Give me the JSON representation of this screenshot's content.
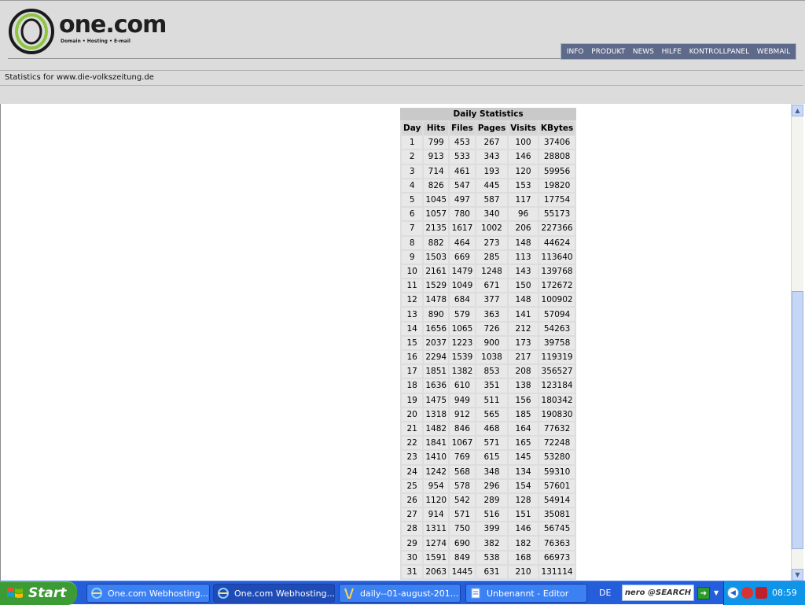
{
  "header": {
    "logo_text": "one.com",
    "logo_tagline": "Domain • Hosting • E-mail",
    "stats_label": "Statistics for www.die-volkszeitung.de"
  },
  "nav": {
    "items": [
      "INFO",
      "PRODUKT",
      "NEWS",
      "HILFE",
      "KONTROLLPANEL",
      "WEBMAIL"
    ]
  },
  "daily_table": {
    "title": "Daily Statistics",
    "columns": [
      "Day",
      "Hits",
      "Files",
      "Pages",
      "Visits",
      "KBytes"
    ],
    "rows": [
      [
        "1",
        "799",
        "453",
        "267",
        "100",
        "37406"
      ],
      [
        "2",
        "913",
        "533",
        "343",
        "146",
        "28808"
      ],
      [
        "3",
        "714",
        "461",
        "193",
        "120",
        "59956"
      ],
      [
        "4",
        "826",
        "547",
        "445",
        "153",
        "19820"
      ],
      [
        "5",
        "1045",
        "497",
        "587",
        "117",
        "17754"
      ],
      [
        "6",
        "1057",
        "780",
        "340",
        "96",
        "55173"
      ],
      [
        "7",
        "2135",
        "1617",
        "1002",
        "206",
        "227366"
      ],
      [
        "8",
        "882",
        "464",
        "273",
        "148",
        "44624"
      ],
      [
        "9",
        "1503",
        "669",
        "285",
        "113",
        "113640"
      ],
      [
        "10",
        "2161",
        "1479",
        "1248",
        "143",
        "139768"
      ],
      [
        "11",
        "1529",
        "1049",
        "671",
        "150",
        "172672"
      ],
      [
        "12",
        "1478",
        "684",
        "377",
        "148",
        "100902"
      ],
      [
        "13",
        "890",
        "579",
        "363",
        "141",
        "57094"
      ],
      [
        "14",
        "1656",
        "1065",
        "726",
        "212",
        "54263"
      ],
      [
        "15",
        "2037",
        "1223",
        "900",
        "173",
        "39758"
      ],
      [
        "16",
        "2294",
        "1539",
        "1038",
        "217",
        "119319"
      ],
      [
        "17",
        "1851",
        "1382",
        "853",
        "208",
        "356527"
      ],
      [
        "18",
        "1636",
        "610",
        "351",
        "138",
        "123184"
      ],
      [
        "19",
        "1475",
        "949",
        "511",
        "156",
        "180342"
      ],
      [
        "20",
        "1318",
        "912",
        "565",
        "185",
        "190830"
      ],
      [
        "21",
        "1482",
        "846",
        "468",
        "164",
        "77632"
      ],
      [
        "22",
        "1841",
        "1067",
        "571",
        "165",
        "72248"
      ],
      [
        "23",
        "1410",
        "769",
        "615",
        "145",
        "53280"
      ],
      [
        "24",
        "1242",
        "568",
        "348",
        "134",
        "59310"
      ],
      [
        "25",
        "954",
        "578",
        "296",
        "154",
        "57601"
      ],
      [
        "26",
        "1120",
        "542",
        "289",
        "128",
        "54914"
      ],
      [
        "27",
        "914",
        "571",
        "516",
        "151",
        "35081"
      ],
      [
        "28",
        "1311",
        "750",
        "399",
        "146",
        "56745"
      ],
      [
        "29",
        "1274",
        "690",
        "382",
        "182",
        "76363"
      ],
      [
        "30",
        "1591",
        "849",
        "538",
        "168",
        "66973"
      ],
      [
        "31",
        "2063",
        "1445",
        "631",
        "210",
        "131114"
      ]
    ]
  },
  "scrollbar": {
    "up_icon": "arrow-up-icon",
    "down_icon": "arrow-down-icon"
  },
  "taskbar": {
    "start_label": "Start",
    "tasks": [
      {
        "label": "One.com Webhosting...",
        "icon": "internet-explorer-icon",
        "active": false
      },
      {
        "label": "One.com Webhosting...",
        "icon": "internet-explorer-icon",
        "active": true
      },
      {
        "label": "daily--01-august-201...",
        "icon": "paint-icon",
        "active": false
      },
      {
        "label": "Unbenannt - Editor",
        "icon": "notepad-icon",
        "active": false
      }
    ],
    "language": "DE",
    "search_brand": "nero @SEARCH",
    "clock": "08:59"
  }
}
